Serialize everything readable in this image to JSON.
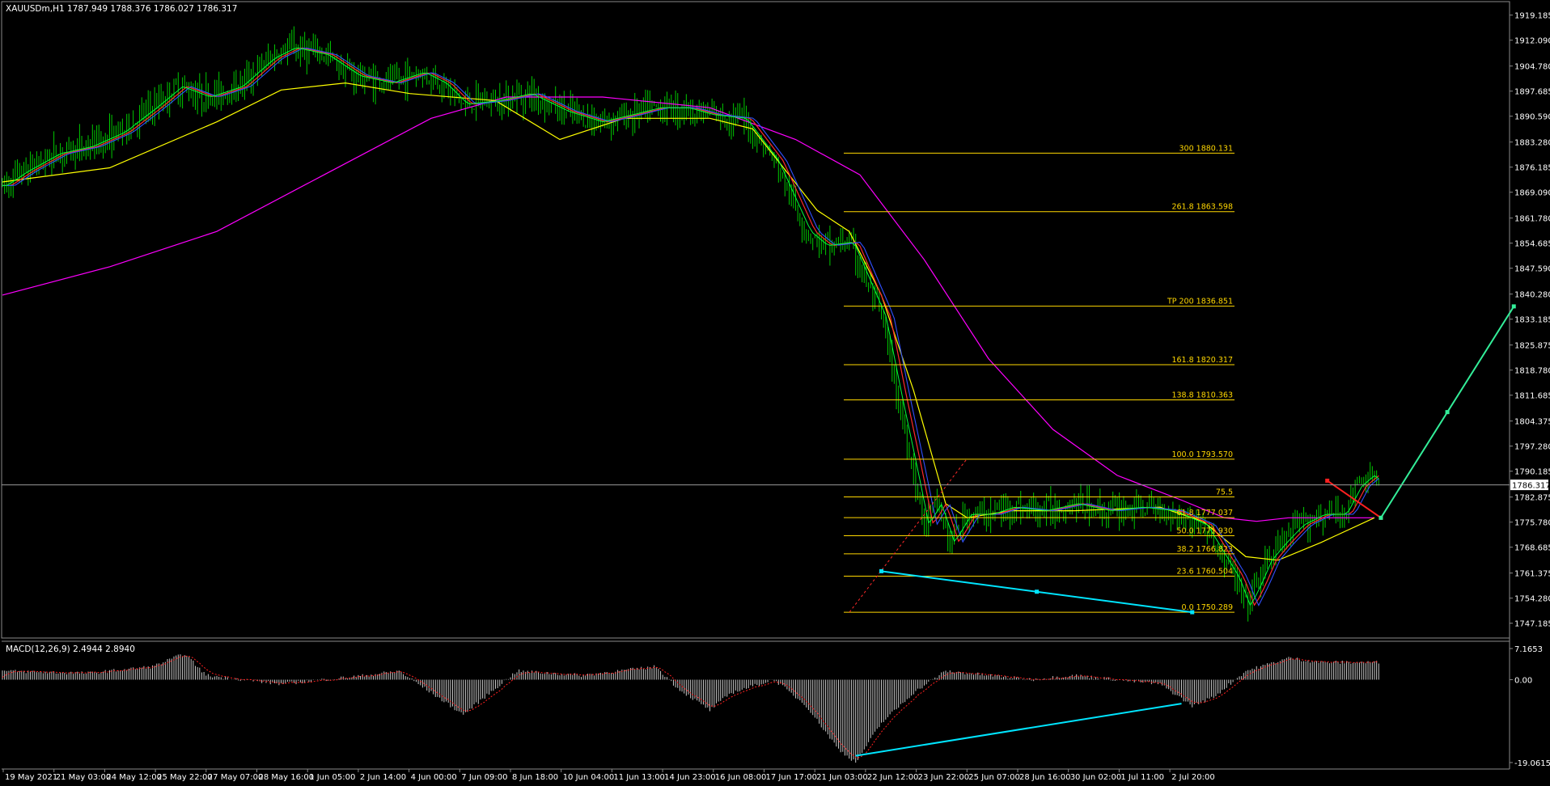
{
  "chart_data": {
    "type": "candlestick",
    "title": "XAUUSDm,H1  1787.949 1788.376 1786.027 1786.317",
    "symbol": "XAUUSDm",
    "timeframe": "H1",
    "ohlc_header": [
      "1787.949",
      "1788.376",
      "1786.027",
      "1786.317"
    ],
    "current_price": 1786.317,
    "current_price_label": "1786.317",
    "price_axis": {
      "ylim": [
        1743.0,
        1923.0
      ],
      "ticks": [
        {
          "value": 1919.185,
          "label": "1919.185"
        },
        {
          "value": 1912.09,
          "label": "1912.090"
        },
        {
          "value": 1904.78,
          "label": "1904.780"
        },
        {
          "value": 1897.685,
          "label": "1897.685"
        },
        {
          "value": 1890.59,
          "label": "1890.590"
        },
        {
          "value": 1883.28,
          "label": "1883.280"
        },
        {
          "value": 1876.185,
          "label": "1876.185"
        },
        {
          "value": 1869.09,
          "label": "1869.090"
        },
        {
          "value": 1861.78,
          "label": "1861.780"
        },
        {
          "value": 1854.685,
          "label": "1854.685"
        },
        {
          "value": 1847.59,
          "label": "1847.590"
        },
        {
          "value": 1840.28,
          "label": "1840.280"
        },
        {
          "value": 1833.185,
          "label": "1833.185"
        },
        {
          "value": 1825.875,
          "label": "1825.875"
        },
        {
          "value": 1818.78,
          "label": "1818.780"
        },
        {
          "value": 1811.685,
          "label": "1811.685"
        },
        {
          "value": 1804.375,
          "label": "1804.375"
        },
        {
          "value": 1797.28,
          "label": "1797.280"
        },
        {
          "value": 1790.185,
          "label": "1790.185"
        },
        {
          "value": 1782.875,
          "label": "1782.875"
        },
        {
          "value": 1775.78,
          "label": "1775.780"
        },
        {
          "value": 1768.685,
          "label": "1768.685"
        },
        {
          "value": 1761.375,
          "label": "1761.375"
        },
        {
          "value": 1754.28,
          "label": "1754.280"
        },
        {
          "value": 1747.185,
          "label": "1747.185"
        }
      ]
    },
    "time_axis": [
      "19 May 2021",
      "21 May 03:00",
      "24 May 12:00",
      "25 May 22:00",
      "27 May 07:00",
      "28 May 16:00",
      "1 Jun 05:00",
      "2 Jun 14:00",
      "4 Jun 00:00",
      "7 Jun 09:00",
      "8 Jun 18:00",
      "10 Jun 04:00",
      "11 Jun 13:00",
      "14 Jun 23:00",
      "16 Jun 08:00",
      "17 Jun 17:00",
      "21 Jun 03:00",
      "22 Jun 12:00",
      "23 Jun 22:00",
      "25 Jun 07:00",
      "28 Jun 16:00",
      "30 Jun 02:00",
      "1 Jul 11:00",
      "2 Jul 20:00"
    ],
    "price_series": [
      [
        0,
        1871
      ],
      [
        10,
        1875
      ],
      [
        25,
        1880
      ],
      [
        40,
        1882
      ],
      [
        55,
        1886
      ],
      [
        70,
        1893
      ],
      [
        82,
        1899
      ],
      [
        95,
        1896
      ],
      [
        110,
        1899
      ],
      [
        125,
        1907
      ],
      [
        135,
        1910
      ],
      [
        150,
        1908
      ],
      [
        165,
        1902
      ],
      [
        180,
        1900
      ],
      [
        195,
        1903
      ],
      [
        205,
        1900
      ],
      [
        215,
        1894
      ],
      [
        230,
        1895
      ],
      [
        245,
        1897
      ],
      [
        262,
        1892
      ],
      [
        278,
        1889
      ],
      [
        292,
        1891
      ],
      [
        305,
        1893
      ],
      [
        318,
        1893
      ],
      [
        330,
        1891
      ],
      [
        345,
        1890
      ],
      [
        360,
        1878
      ],
      [
        375,
        1858
      ],
      [
        383,
        1854
      ],
      [
        395,
        1855
      ],
      [
        410,
        1834
      ],
      [
        418,
        1810
      ],
      [
        425,
        1790
      ],
      [
        430,
        1775
      ],
      [
        436,
        1781
      ],
      [
        442,
        1770
      ],
      [
        450,
        1778
      ],
      [
        460,
        1778
      ],
      [
        470,
        1780
      ],
      [
        485,
        1779
      ],
      [
        500,
        1781
      ],
      [
        515,
        1779
      ],
      [
        530,
        1780
      ],
      [
        545,
        1779
      ],
      [
        560,
        1775
      ],
      [
        568,
        1767
      ],
      [
        575,
        1760
      ],
      [
        580,
        1752
      ],
      [
        585,
        1758
      ],
      [
        590,
        1765
      ],
      [
        597,
        1770
      ],
      [
        605,
        1775
      ],
      [
        615,
        1778
      ],
      [
        625,
        1778
      ],
      [
        632,
        1786
      ],
      [
        638,
        1789
      ],
      [
        642,
        1787
      ]
    ],
    "moving_averages": [
      {
        "name": "MA magenta",
        "color": "#ff00ff",
        "points": [
          [
            0,
            1840
          ],
          [
            50,
            1848
          ],
          [
            100,
            1858
          ],
          [
            150,
            1874
          ],
          [
            200,
            1890
          ],
          [
            235,
            1896
          ],
          [
            280,
            1896
          ],
          [
            330,
            1893
          ],
          [
            370,
            1884
          ],
          [
            400,
            1874
          ],
          [
            430,
            1850
          ],
          [
            460,
            1822
          ],
          [
            490,
            1802
          ],
          [
            520,
            1789
          ],
          [
            550,
            1782
          ],
          [
            570,
            1777
          ],
          [
            585,
            1776
          ],
          [
            600,
            1777
          ],
          [
            640,
            1777
          ]
        ]
      },
      {
        "name": "MA yellow",
        "color": "#ffff00",
        "points": [
          [
            0,
            1872
          ],
          [
            50,
            1876
          ],
          [
            100,
            1889
          ],
          [
            130,
            1898
          ],
          [
            160,
            1900
          ],
          [
            190,
            1897
          ],
          [
            230,
            1895
          ],
          [
            260,
            1884
          ],
          [
            290,
            1890
          ],
          [
            330,
            1890
          ],
          [
            350,
            1887
          ],
          [
            380,
            1864
          ],
          [
            395,
            1858
          ],
          [
            410,
            1840
          ],
          [
            425,
            1813
          ],
          [
            440,
            1781
          ],
          [
            450,
            1777
          ],
          [
            470,
            1779
          ],
          [
            500,
            1779
          ],
          [
            540,
            1780
          ],
          [
            560,
            1776
          ],
          [
            580,
            1766
          ],
          [
            595,
            1765
          ],
          [
            615,
            1770
          ],
          [
            640,
            1777
          ]
        ]
      }
    ],
    "fibonacci_levels": [
      {
        "level": 0.0,
        "price": 1750.289,
        "label": "0.0 1750.289"
      },
      {
        "level": 23.6,
        "price": 1760.504,
        "label": "23.6 1760.504"
      },
      {
        "level": 38.2,
        "price": 1766.823,
        "label": "38.2 1766.823"
      },
      {
        "level": 50.0,
        "price": 1771.93,
        "label": "50.0 1771.930"
      },
      {
        "level": 61.8,
        "price": 1777.037,
        "label": "61.8 1777.037"
      },
      {
        "level": 75.5,
        "price": 1782.9,
        "label": "75.5"
      },
      {
        "level": 100.0,
        "price": 1793.57,
        "label": "100.0 1793.570"
      },
      {
        "level": 138.8,
        "price": 1810.363,
        "label": "138.8 1810.363"
      },
      {
        "level": 161.8,
        "price": 1820.317,
        "label": "161.8 1820.317"
      },
      {
        "level": 200.0,
        "price": 1836.851,
        "label": "TP 200 1836.851"
      },
      {
        "level": 261.8,
        "price": 1863.598,
        "label": "261.8 1863.598"
      },
      {
        "level": 300.0,
        "price": 1880.131,
        "label": "300 1880.131"
      }
    ],
    "annotations": {
      "support_trendline": {
        "color": "#00e5ff",
        "points": [
          [
            410,
            1761.9
          ],
          [
            555,
            1750.3
          ]
        ]
      },
      "projection_down": {
        "color": "#ff2020",
        "points": [
          [
            618,
            1787.5
          ],
          [
            643,
            1777.0
          ]
        ]
      },
      "projection_up": {
        "color": "#33ee99",
        "points": [
          [
            643,
            1777.0
          ],
          [
            705,
            1836.8
          ]
        ]
      }
    },
    "indicator": {
      "name": "MACD(12,26,9)",
      "label": "MACD(12,26,9) 2.4944 2.8940",
      "values_text": [
        "2.4944",
        "2.8940"
      ],
      "ylim": [
        -19.0615,
        7.1653
      ],
      "ticks": [
        {
          "value": 7.1653,
          "label": "7.1653"
        },
        {
          "value": 0.0,
          "label": "0.00"
        },
        {
          "value": -19.0615,
          "label": "-19.0615"
        }
      ],
      "histogram_profile": [
        [
          0,
          2
        ],
        [
          40,
          1.5
        ],
        [
          70,
          3
        ],
        [
          85,
          6
        ],
        [
          95,
          1
        ],
        [
          130,
          -1
        ],
        [
          170,
          1
        ],
        [
          185,
          2
        ],
        [
          200,
          -3
        ],
        [
          215,
          -8
        ],
        [
          225,
          -4
        ],
        [
          240,
          2
        ],
        [
          270,
          1
        ],
        [
          305,
          3
        ],
        [
          315,
          -2
        ],
        [
          330,
          -7
        ],
        [
          340,
          -3
        ],
        [
          360,
          0
        ],
        [
          375,
          -6
        ],
        [
          390,
          -16
        ],
        [
          398,
          -19
        ],
        [
          410,
          -10
        ],
        [
          425,
          -3
        ],
        [
          440,
          2
        ],
        [
          460,
          1
        ],
        [
          480,
          0
        ],
        [
          500,
          1
        ],
        [
          520,
          0
        ],
        [
          540,
          -1
        ],
        [
          555,
          -6
        ],
        [
          565,
          -4
        ],
        [
          580,
          2
        ],
        [
          600,
          5
        ],
        [
          615,
          4
        ],
        [
          640,
          4
        ]
      ],
      "divergence_line": {
        "color": "#00e5ff",
        "points": [
          [
            398,
            -17.5
          ],
          [
            550,
            -5.5
          ]
        ]
      }
    }
  }
}
